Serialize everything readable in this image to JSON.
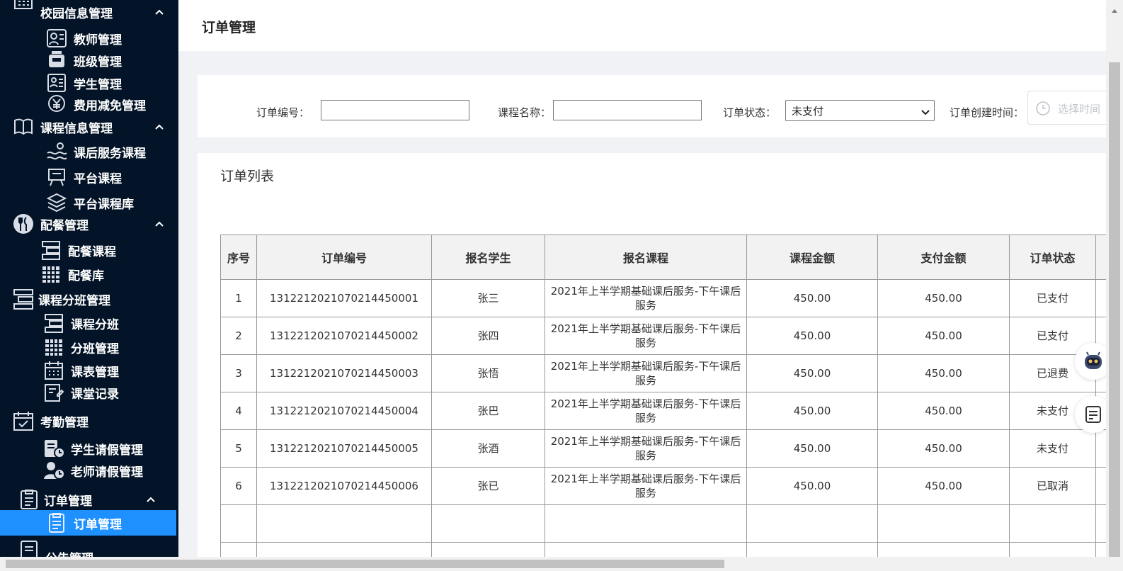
{
  "sidebar": {
    "groups": [
      {
        "label": "校园信息管理",
        "icon": "school-building-icon"
      },
      {
        "label": "课程信息管理",
        "icon": "book-icon"
      },
      {
        "label": "配餐管理",
        "icon": "fork-knife-icon"
      },
      {
        "label": "课程分班管理",
        "icon": "layers-icon"
      },
      {
        "label": "考勤管理",
        "icon": "calendar-check-icon"
      },
      {
        "label": "订单管理",
        "icon": "clipboard-icon"
      },
      {
        "label": "公告管理",
        "icon": "notice-icon"
      }
    ],
    "items": [
      {
        "label": "教师管理",
        "icon": "teacher-icon"
      },
      {
        "label": "班级管理",
        "icon": "class-icon"
      },
      {
        "label": "学生管理",
        "icon": "student-card-icon"
      },
      {
        "label": "费用减免管理",
        "icon": "yen-coin-icon"
      },
      {
        "label": "课后服务课程",
        "icon": "after-school-icon"
      },
      {
        "label": "平台课程",
        "icon": "presentation-icon"
      },
      {
        "label": "平台课程库",
        "icon": "stack-icon"
      },
      {
        "label": "配餐课程",
        "icon": "menu-list-icon"
      },
      {
        "label": "配餐库",
        "icon": "grid-calendar-icon"
      },
      {
        "label": "课程分班",
        "icon": "split-icon"
      },
      {
        "label": "分班管理",
        "icon": "grid-calendar-icon"
      },
      {
        "label": "课表管理",
        "icon": "schedule-icon"
      },
      {
        "label": "课堂记录",
        "icon": "record-icon"
      },
      {
        "label": "学生请假管理",
        "icon": "student-leave-icon"
      },
      {
        "label": "老师请假管理",
        "icon": "teacher-leave-icon"
      },
      {
        "label": "订单管理",
        "icon": "order-icon"
      }
    ]
  },
  "header": {
    "title": "订单管理"
  },
  "filters": {
    "order_no_label": "订单编号：",
    "course_name_label": "课程名称：",
    "status_label": "订单状态：",
    "status_value": "未支付",
    "created_time_label": "订单创建时间：",
    "date_placeholder": "选择时间"
  },
  "list": {
    "title": "订单列表",
    "columns": [
      "序号",
      "订单编号",
      "报名学生",
      "报名课程",
      "课程金额",
      "支付金额",
      "订单状态"
    ],
    "rows": [
      [
        "1",
        "1312212021070214450001",
        "张三",
        "2021年上半学期基础课后服务-下午课后服务",
        "450.00",
        "450.00",
        "已支付"
      ],
      [
        "2",
        "1312212021070214450002",
        "张四",
        "2021年上半学期基础课后服务-下午课后服务",
        "450.00",
        "450.00",
        "已支付"
      ],
      [
        "3",
        "1312212021070214450003",
        "张悟",
        "2021年上半学期基础课后服务-下午课后服务",
        "450.00",
        "450.00",
        "已退费"
      ],
      [
        "4",
        "1312212021070214450004",
        "张巴",
        "2021年上半学期基础课后服务-下午课后服务",
        "450.00",
        "450.00",
        "未支付"
      ],
      [
        "5",
        "1312212021070214450005",
        "张酒",
        "2021年上半学期基础课后服务-下午课后服务",
        "450.00",
        "450.00",
        "未支付"
      ],
      [
        "6",
        "1312212021070214450006",
        "张已",
        "2021年上半学期基础课后服务-下午课后服务",
        "450.00",
        "450.00",
        "已取消"
      ]
    ]
  },
  "colors": {
    "sidebar_bg": "#031428",
    "active_bg": "#1e90ff",
    "panel_bg": "#ffffff",
    "page_bg": "#f0f2f5"
  }
}
